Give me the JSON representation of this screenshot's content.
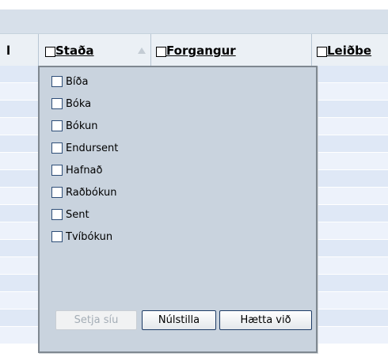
{
  "table": {
    "header_cols": [
      {
        "label": "l"
      },
      {
        "label": "Staða"
      },
      {
        "label": "Forgangur"
      },
      {
        "label": "Leiðbe"
      }
    ]
  },
  "filter_popup": {
    "options": [
      "Bíða",
      "Bóka",
      "Bókun",
      "Endursent",
      "Hafnað",
      "Raðbókun",
      "Sent",
      "Tvíbókun"
    ],
    "buttons": {
      "apply": "Setja síu",
      "reset": "Núlstilla",
      "cancel": "Hætta við"
    }
  }
}
